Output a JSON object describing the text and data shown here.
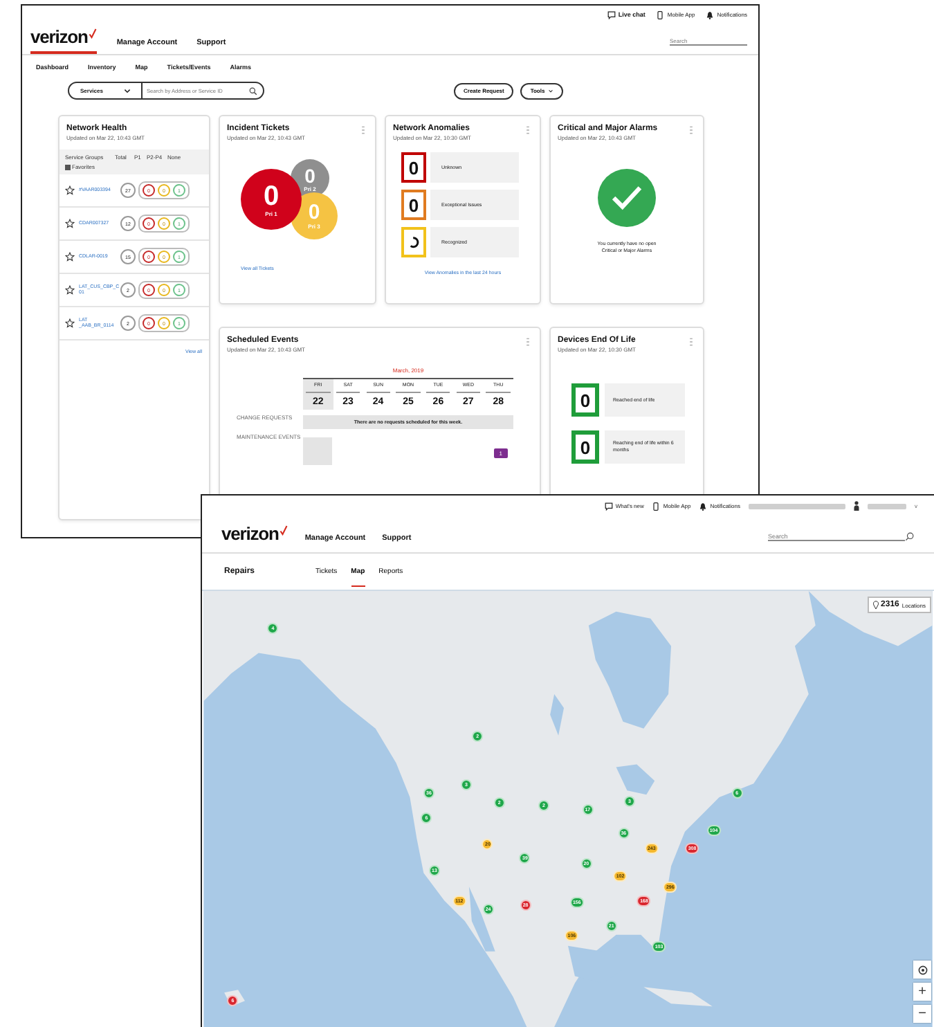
{
  "back_window": {
    "header": {
      "logo": "verizon",
      "nav": [
        "Manage Account",
        "Support"
      ],
      "utilities": [
        {
          "kind": "chat",
          "label": "Live chat"
        },
        {
          "kind": "phone",
          "label": "Mobile App"
        },
        {
          "kind": "bell",
          "label": "Notifications"
        }
      ],
      "search": {
        "placeholder": "Search"
      }
    },
    "tabs": [
      "Dashboard",
      "Inventory",
      "Map",
      "Tickets/Events",
      "Alarms"
    ],
    "filter": {
      "select": "Services",
      "search": {
        "placeholder": "Search by Address or Service ID"
      }
    },
    "buttons": [
      {
        "label": "Create Request",
        "kind": "plain"
      },
      {
        "label": "Tools",
        "kind": "menu"
      }
    ],
    "network_health": {
      "title": "Network Health",
      "updated": "Updated on Mar 22, 10:43 GMT",
      "columns": [
        "Service Groups",
        "Total",
        "P1",
        "P2-P4",
        "None"
      ],
      "favorites": {
        "label": "Favorites",
        "checked": true
      },
      "rows": [
        {
          "name": "#VAAR003394",
          "total": "27",
          "p1": "0",
          "p2": "0",
          "none": "1"
        },
        {
          "name": "CDAR007327",
          "total": "12",
          "p1": "0",
          "p2": "0",
          "none": "1"
        },
        {
          "name": "CDLAR-0019",
          "total": "15",
          "p1": "0",
          "p2": "0",
          "none": "1"
        },
        {
          "name": "LAT_CUS_CBP_C 01",
          "total": "2",
          "p1": "0",
          "p2": "0",
          "none": "1"
        },
        {
          "name": "LAT _AAB_BR_0114",
          "total": "2",
          "p1": "0",
          "p2": "0",
          "none": "1"
        }
      ],
      "link": "View all"
    },
    "incident_tickets": {
      "title": "Incident Tickets",
      "updated": "Updated on Mar 22, 10:43 GMT",
      "bubbles": [
        {
          "kind": "p2",
          "count": "0",
          "label": "Pri 2"
        },
        {
          "kind": "p3",
          "count": "0",
          "label": "Pri 3"
        },
        {
          "kind": "p1",
          "count": "0",
          "label": "Pri 1"
        }
      ],
      "link": "View all Tickets"
    },
    "network_anomalies": {
      "title": "Network Anomalies",
      "updated": "Updated on Mar 22, 10:30 GMT",
      "items": [
        {
          "kind": "count",
          "count": "0",
          "label": "Unknown",
          "color": "#c00000"
        },
        {
          "kind": "count",
          "count": "0",
          "label": "Exceptional Issues",
          "color": "#e07b20"
        },
        {
          "kind": "loading",
          "label": "Recognized",
          "color": "#f2c21b"
        }
      ],
      "link": "View Anomalies in the last 24 hours"
    },
    "critical_alarms": {
      "title": "Critical and Major Alarms",
      "updated": "Updated on Mar 22, 10:43 GMT",
      "message": "You currently have no open Critical or Major Alarms"
    },
    "scheduled_events": {
      "title": "Scheduled Events",
      "updated": "Updated on Mar 22, 10:43 GMT",
      "month": "March, 2019",
      "days": [
        {
          "dow": "FRI",
          "date": "22",
          "selected": true
        },
        {
          "dow": "SAT",
          "date": "23",
          "selected": false
        },
        {
          "dow": "SUN",
          "date": "24",
          "selected": false
        },
        {
          "dow": "MON",
          "date": "25",
          "selected": false
        },
        {
          "dow": "TUE",
          "date": "26",
          "selected": false
        },
        {
          "dow": "WED",
          "date": "27",
          "selected": false
        },
        {
          "dow": "THU",
          "date": "28",
          "selected": false
        }
      ],
      "rows": [
        {
          "kind": "message",
          "label": "CHANGE REQUESTS",
          "message": "There are no requests scheduled for this week."
        },
        {
          "kind": "badge",
          "label": "MAINTENANCE EVENTS",
          "badge": "1"
        }
      ]
    },
    "devices_end_of_life": {
      "title": "Devices End Of Life",
      "updated": "Updated on Mar 22, 10:30 GMT",
      "items": [
        {
          "count": "0",
          "label": "Reached end of life"
        },
        {
          "count": "0",
          "label": "Reaching end of life within 6 months"
        }
      ]
    }
  },
  "front_window": {
    "header": {
      "logo": "verizon",
      "nav": [
        "Manage Account",
        "Support"
      ],
      "utilities": [
        {
          "kind": "chat",
          "label": "What's new"
        },
        {
          "kind": "phone",
          "label": "Mobile App"
        },
        {
          "kind": "bell",
          "label": "Notifications"
        }
      ],
      "account_caret": "v",
      "search": {
        "placeholder": "Search"
      }
    },
    "section": "Repairs",
    "tabs": [
      {
        "label": "Tickets",
        "selected": false
      },
      {
        "label": "Map",
        "selected": true
      },
      {
        "label": "Reports",
        "selected": false
      }
    ],
    "map": {
      "kind": "picture",
      "locations": {
        "count": "2316",
        "label": "Locations"
      },
      "markers": [
        {
          "label": "4",
          "kind": "ok"
        },
        {
          "label": "2",
          "kind": "ok"
        },
        {
          "label": "3",
          "kind": "ok"
        },
        {
          "label": "36",
          "kind": "ok"
        },
        {
          "label": "6",
          "kind": "ok"
        },
        {
          "label": "2",
          "kind": "ok"
        },
        {
          "label": "2",
          "kind": "ok"
        },
        {
          "label": "17",
          "kind": "ok"
        },
        {
          "label": "3",
          "kind": "ok"
        },
        {
          "label": "6",
          "kind": "ok"
        },
        {
          "label": "36",
          "kind": "ok"
        },
        {
          "label": "104",
          "kind": "ok"
        },
        {
          "label": "20",
          "kind": "warn"
        },
        {
          "label": "243",
          "kind": "warn"
        },
        {
          "label": "308",
          "kind": "alert"
        },
        {
          "label": "39",
          "kind": "ok"
        },
        {
          "label": "20",
          "kind": "ok"
        },
        {
          "label": "13",
          "kind": "ok"
        },
        {
          "label": "102",
          "kind": "warn"
        },
        {
          "label": "296",
          "kind": "warn"
        },
        {
          "label": "112",
          "kind": "warn"
        },
        {
          "label": "24",
          "kind": "ok"
        },
        {
          "label": "28",
          "kind": "alert"
        },
        {
          "label": "156",
          "kind": "ok"
        },
        {
          "label": "168",
          "kind": "alert"
        },
        {
          "label": "21",
          "kind": "ok"
        },
        {
          "label": "106",
          "kind": "warn"
        },
        {
          "label": "103",
          "kind": "ok"
        },
        {
          "label": "6",
          "kind": "alert"
        }
      ],
      "controls": [
        {
          "kind": "locate"
        },
        {
          "kind": "zoom_in",
          "label": "+"
        },
        {
          "kind": "zoom_out",
          "label": "−"
        }
      ]
    }
  }
}
